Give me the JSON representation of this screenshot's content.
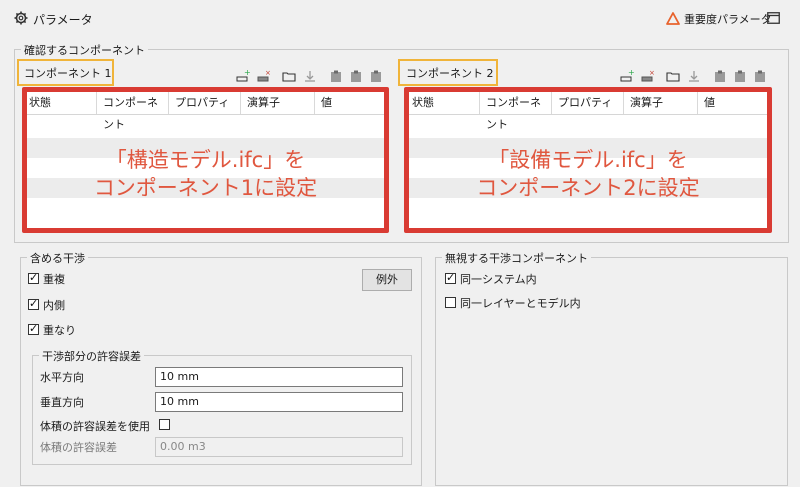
{
  "header": {
    "title": "パラメータ",
    "importance_label": "重要度パラメータ"
  },
  "components_group": {
    "title": "確認するコンポーネント",
    "left": {
      "label": "コンポーネント 1",
      "columns": [
        "状態",
        "コンポーネント",
        "プロパティ",
        "演算子",
        "値"
      ],
      "annotation": "「構造モデル.ifc」を\nコンポーネント1に設定"
    },
    "right": {
      "label": "コンポーネント 2",
      "columns": [
        "状態",
        "コンポーネント",
        "プロパティ",
        "演算子",
        "値"
      ],
      "annotation": "「設備モデル.ifc」を\nコンポーネント2に設定"
    }
  },
  "include_group": {
    "title": "含める干渉",
    "exception_button": "例外",
    "checks": [
      {
        "label": "重複",
        "checked": true
      },
      {
        "label": "内側",
        "checked": true
      },
      {
        "label": "重なり",
        "checked": true
      }
    ],
    "tolerance": {
      "title": "干渉部分の許容誤差",
      "horizontal_label": "水平方向",
      "horizontal_value": "10 mm",
      "vertical_label": "垂直方向",
      "vertical_value": "10 mm",
      "volume_use_label": "体積の許容誤差を使用",
      "volume_use_checked": false,
      "volume_label": "体積の許容誤差",
      "volume_value": "0.00 m3"
    }
  },
  "ignore_group": {
    "title": "無視する干渉コンポーネント",
    "checks": [
      {
        "label": "同一システム内",
        "checked": true
      },
      {
        "label": "同一レイヤーとモデル内",
        "checked": false
      }
    ]
  },
  "colors": {
    "annotation_red": "#d93b33",
    "annotation_text": "#e0573f",
    "highlight_orange": "#f0b43a"
  }
}
